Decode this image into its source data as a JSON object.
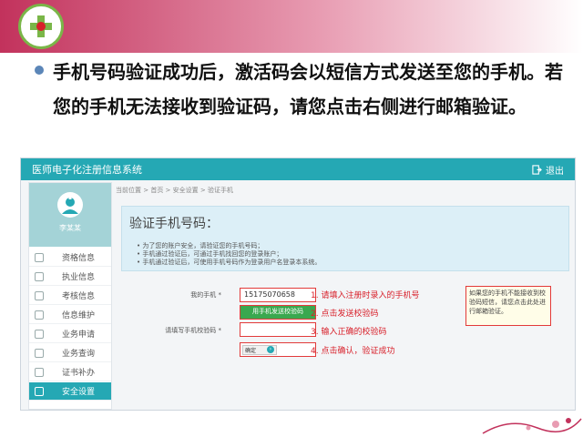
{
  "slide": {
    "text": "手机号码验证成功后，激活码会以短信方式发送至您的手机。若您的手机无法接收到验证码，请您点击右侧进行邮箱验证。"
  },
  "app": {
    "title": "医师电子化注册信息系统",
    "logout_label": "退出",
    "user_label": "李某某",
    "breadcrumb": "当前位置 > 首页 > 安全设置 > 验证手机",
    "nav": [
      {
        "label": "资格信息"
      },
      {
        "label": "执业信息"
      },
      {
        "label": "考核信息"
      },
      {
        "label": "信息维护"
      },
      {
        "label": "业务申请"
      },
      {
        "label": "业务查询"
      },
      {
        "label": "证书补办"
      },
      {
        "label": "安全设置"
      }
    ],
    "info": {
      "title": "验证手机号码：",
      "lines": [
        "• 为了您的账户安全，请验证您的手机号码；",
        "• 手机通过验证后，可通过手机找回您的登录账户；",
        "• 手机通过验证后，可使用手机号码作为登录用户名登录本系统。"
      ]
    },
    "form": {
      "phone_label": "我的手机 *",
      "phone_value": "15175070658",
      "send_button": "用手机发送校验码",
      "code_label": "请填写手机校验码 *",
      "confirm_button": "确定"
    },
    "steps": [
      "1. 请填入注册时录入的手机号",
      "2. 点击发送校验码",
      "3. 输入正确的校验码",
      "4. 点击确认，验证成功"
    ],
    "side_note": "如果您的手机不能接收到校验码短信，请您点击此处进行邮箱验证。"
  },
  "colors": {
    "teal": "#25a8b4",
    "slide_band": "#c2325c",
    "highlight_red": "#e23a3a",
    "button_green": "#3aa84f"
  }
}
